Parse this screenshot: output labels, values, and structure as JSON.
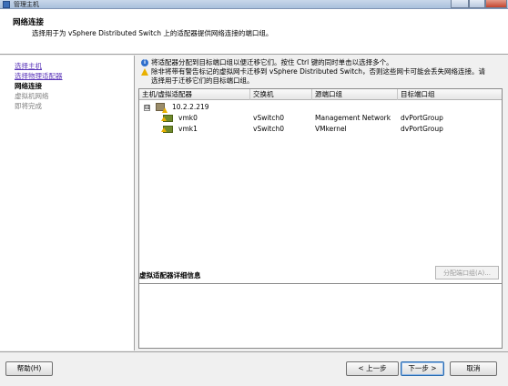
{
  "window": {
    "title": "管理主机"
  },
  "header": {
    "title": "网络连接",
    "subtitle": "选择用于为 vSphere Distributed Switch 上的适配器提供网络连接的端口组。"
  },
  "steps": [
    {
      "label": "选择主机",
      "state": "link"
    },
    {
      "label": "选择物理适配器",
      "state": "link"
    },
    {
      "label": "网络连接",
      "state": "current"
    },
    {
      "label": "虚拟机网络",
      "state": "future"
    },
    {
      "label": "即将完成",
      "state": "future"
    }
  ],
  "info": {
    "tip": "将适配器分配到目标端口组以便迁移它们。按住 Ctrl 键的同时单击以选择多个。",
    "warning_line1": "除非将带有警告标记的虚拟网卡迁移到 vSphere Distributed Switch，否则这些网卡可能会丢失网络连接。请",
    "warning_line2": "选择用于迁移它们的目标端口组。"
  },
  "table": {
    "columns": [
      "主机/虚拟适配器",
      "交换机",
      "源端口组",
      "目标端口组"
    ],
    "host": {
      "name": "10.2.2.219",
      "expander": "⊟"
    },
    "rows": [
      {
        "adapter": "vmk0",
        "switch": "vSwitch0",
        "source": "Management Network",
        "target": "dvPortGroup"
      },
      {
        "adapter": "vmk1",
        "switch": "vSwitch0",
        "source": "VMkernel",
        "target": "dvPortGroup"
      }
    ]
  },
  "details": {
    "label": "虚拟适配器详细信息",
    "assign_button": "分配端口组(A)..."
  },
  "footer": {
    "help": "帮助(H)",
    "back": "< 上一步",
    "next": "下一步 >",
    "cancel": "取消"
  },
  "colors": {
    "link": "#5a34b8",
    "disabled": "#808080",
    "warning": "#e8b000",
    "info": "#2f6fcc"
  },
  "icons": {
    "host": "host-warning-icon",
    "adapter": "vmkernel-nic-warning-icon",
    "info": "info-icon",
    "warning": "warning-icon"
  }
}
